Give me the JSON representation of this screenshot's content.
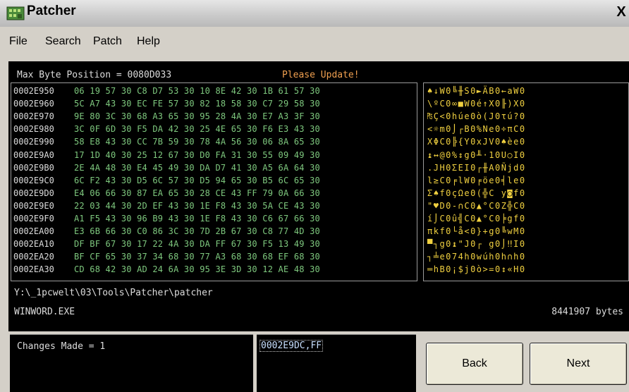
{
  "window": {
    "title": "Patcher",
    "close_glyph": "X"
  },
  "menu": [
    "File",
    "Search",
    "Patch",
    "Help"
  ],
  "status": {
    "max_byte_position": "Max Byte Position = 0080D033",
    "notice": "Please Update!",
    "notice_color": "#f0a050"
  },
  "hex_rows": [
    {
      "addr": "0002E950",
      "bytes": "06 19 57 30 C8 D7 53 30 10 8E 42 30 1B 61 57 30",
      "ascii": "♠↓W0╚╫S0►ÄB0←aW0"
    },
    {
      "addr": "0002E960",
      "bytes": "5C A7 43 30 EC FE 57 30 82 18 58 30 C7 29 58 30",
      "ascii": "\\ºC0∞■W0é↑X0╟)X0"
    },
    {
      "addr": "0002E970",
      "bytes": "9E 80 3C 30 68 A3 65 30 95 28 4A 30 E7 A3 3F 30",
      "ascii": "₧Ç<0húe0ò(J0τú?0"
    },
    {
      "addr": "0002E980",
      "bytes": "3C 0F 6D 30 F5 DA 42 30 25 4E 65 30 F6 E3 43 30",
      "ascii": "<☼m0⌡┌B0%Ne0÷πC0"
    },
    {
      "addr": "0002E990",
      "bytes": "58 E8 43 30 CC 7B 59 30 78 4A 56 30 06 8A 65 30",
      "ascii": "XΦC0╠{Y0xJV0♠èe0"
    },
    {
      "addr": "0002E9A0",
      "bytes": "17 1D 40 30 25 12 67 30 D0 FA 31 30 55 09 49 30",
      "ascii": "↨↔@0%↕g0╨·10U○I0"
    },
    {
      "addr": "0002E9B0",
      "bytes": "2E 4A 48 30 E4 45 49 30 DA D7 41 30 A5 6A 64 30",
      "ascii": ".JH0ΣEI0┌╫A0Ñjd0"
    },
    {
      "addr": "0002E9C0",
      "bytes": "6C F2 43 30 D5 6C 57 30 D5 94 65 30 B5 6C 65 30",
      "ascii": "l≥C0╒lW0╒öe0╡le0"
    },
    {
      "addr": "0002E9D0",
      "bytes": "E4 06 66 30 87 EA 65 30 28 CE 43 FF 79 0A 66 30",
      "ascii": "Σ♠f0çΩe0(╬C y◙f0"
    },
    {
      "addr": "0002E9E0",
      "bytes": "22 03 44 30 2D EF 43 30 1E F8 43 30 5A CE 43 30",
      "ascii": "\"♥D0-∩C0▲°C0Z╬C0"
    },
    {
      "addr": "0002E9F0",
      "bytes": "A1 F5 43 30 96 B9 43 30 1E F8 43 30 C6 67 66 30",
      "ascii": "í⌡C0û╣C0▲°C0╞gf0"
    },
    {
      "addr": "0002EA00",
      "bytes": "E3 6B 66 30 C0 86 3C 30 7D 2B 67 30 C8 77 4D 30",
      "ascii": "πkf0└å<0}+g0╚wM0"
    },
    {
      "addr": "0002EA10",
      "bytes": "DF BF 67 30 17 22 4A 30 DA FF 67 30 F5 13 49 30",
      "ascii": "▀┐g0↨\"J0┌ g0⌡‼I0"
    },
    {
      "addr": "0002EA20",
      "bytes": "BF CF 65 30 37 34 68 30 77 A3 68 30 68 EF 68 30",
      "ascii": "┐╧e074h0wúh0h∩h0"
    },
    {
      "addr": "0002EA30",
      "bytes": "CD 68 42 30 AD 24 6A 30 95 3E 3D 30 12 AE 48 30",
      "ascii": "═hB0¡$j0ò>=0↕«H0"
    }
  ],
  "file": {
    "path": "Y:\\_1pcwelt\\03\\Tools\\Patcher\\patcher",
    "name": "WINWORD.EXE",
    "size": "8441907 bytes"
  },
  "changes": {
    "label": "Changes Made = 1"
  },
  "change_list": [
    "0002E9DC,FF"
  ],
  "buttons": {
    "back": "Back",
    "next": "Next"
  }
}
